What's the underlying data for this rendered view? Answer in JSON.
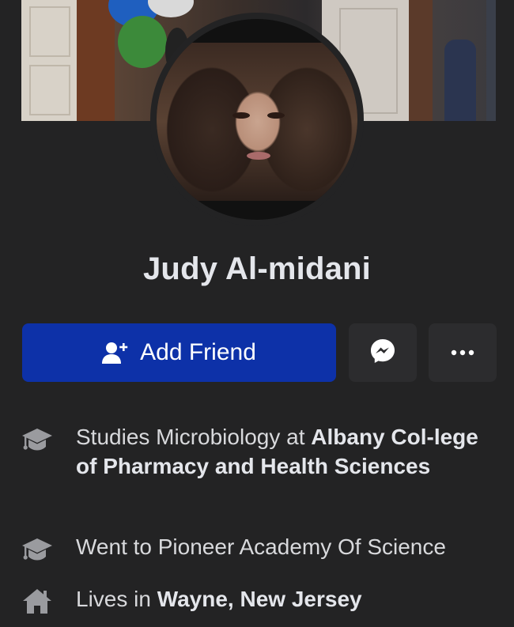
{
  "profile": {
    "name": "Judy Al-midani"
  },
  "actions": {
    "add_friend_label": "Add Friend"
  },
  "info": {
    "studies_prefix": "Studies Microbiology at ",
    "studies_school": "Albany Col-lege of Pharmacy and Health Sciences",
    "went_to": "Went to Pioneer Academy Of Science",
    "lives_prefix": "Lives in ",
    "lives_place": "Wayne, New Jersey"
  },
  "icons": {
    "add_friend": "person-plus-icon",
    "messenger": "messenger-icon",
    "more": "more-dots-icon",
    "education": "graduation-cap-icon",
    "home": "home-icon"
  },
  "colors": {
    "background": "#232324",
    "primary_button": "#0d31a8",
    "secondary_button": "#2c2c2e",
    "text_primary": "#e4e6eb",
    "text_secondary": "#d8d9dc",
    "icon_gray": "#9a9b9f"
  }
}
